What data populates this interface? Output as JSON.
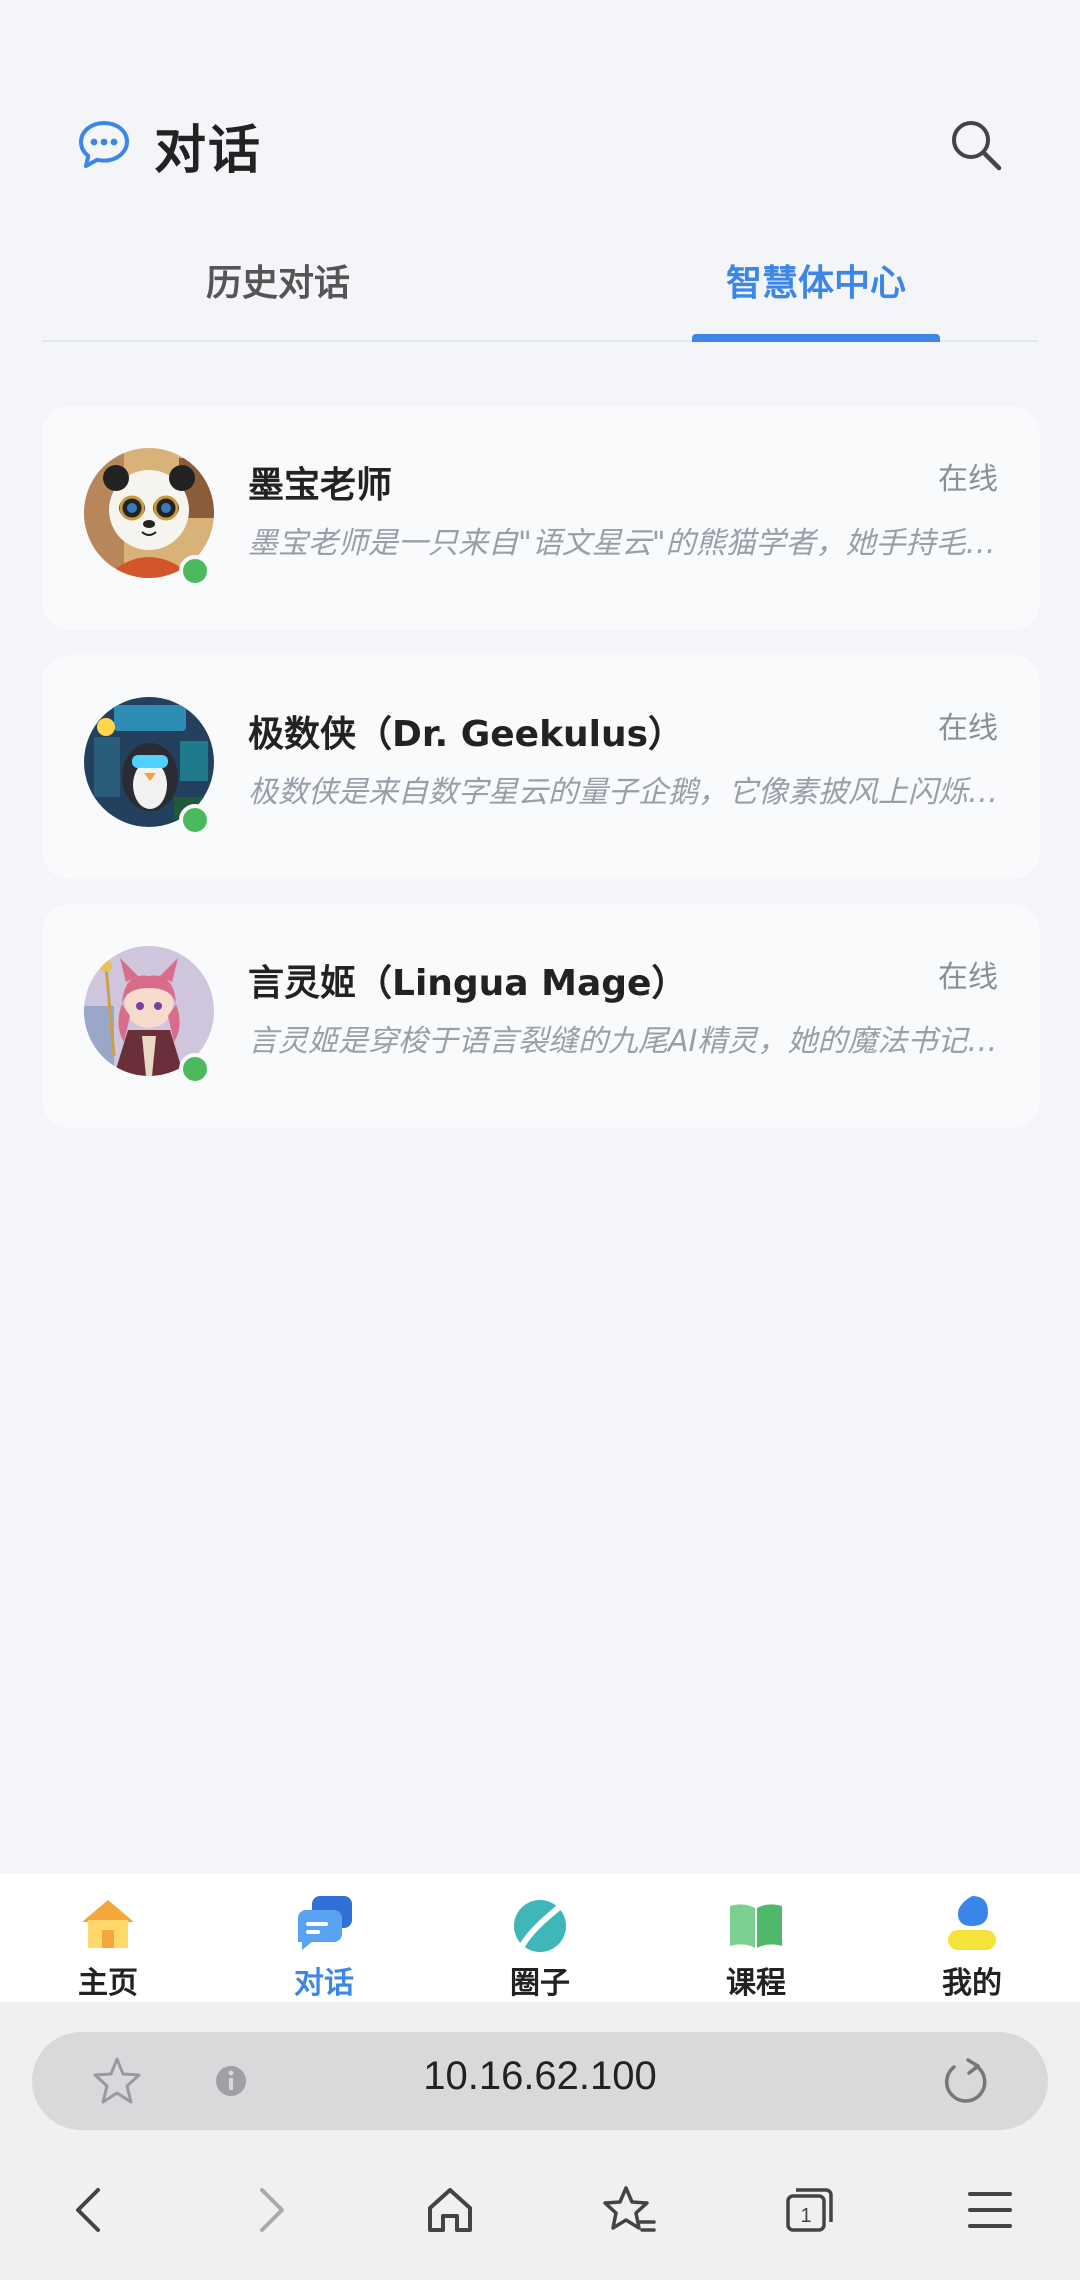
{
  "header": {
    "title": "对话"
  },
  "tabs": [
    {
      "label": "历史对话"
    },
    {
      "label": "智慧体中心"
    }
  ],
  "agents": [
    {
      "name": "墨宝老师",
      "status": "在线",
      "description": "墨宝老师是一只来自\"语文星云\"的熊猫学者，她手持毛笔，以水墨为媒介引导学习"
    },
    {
      "name": "极数侠（Dr. Geekulus）",
      "status": "在线",
      "description": "极数侠是来自数字星云的量子企鹅，它像素披风上闪烁着公式与代码"
    },
    {
      "name": "言灵姬（Lingua Mage）",
      "status": "在线",
      "description": "言灵姬是穿梭于语言裂缝的九尾AI精灵，她的魔法书记录着万千语言"
    }
  ],
  "tabbar": [
    {
      "label": "主页",
      "icon": "home-icon"
    },
    {
      "label": "对话",
      "icon": "chat-bubbles-icon"
    },
    {
      "label": "圈子",
      "icon": "planet-icon"
    },
    {
      "label": "课程",
      "icon": "book-icon"
    },
    {
      "label": "我的",
      "icon": "user-icon"
    }
  ],
  "browser": {
    "url": "10.16.62.100"
  },
  "colors": {
    "accent": "#3b86e8",
    "online": "#4bba5d",
    "background": "#f3f5f9"
  }
}
